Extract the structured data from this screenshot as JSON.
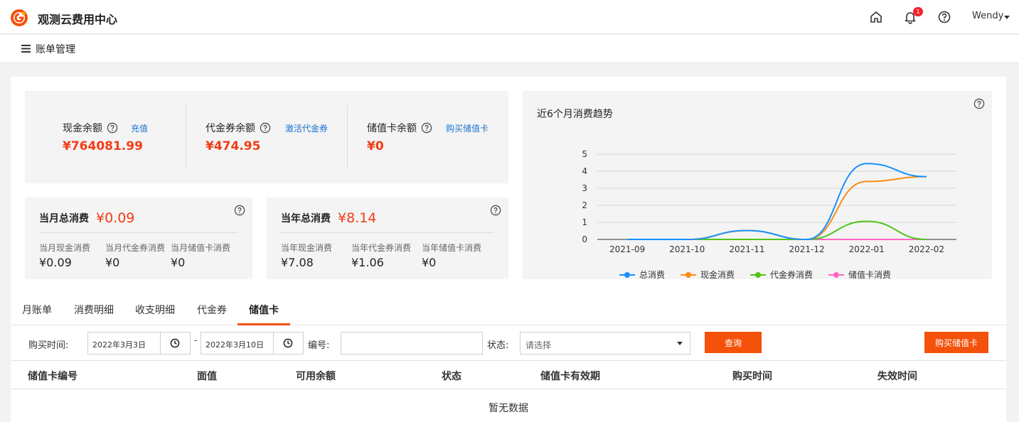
{
  "header": {
    "title": "观测云费用中心",
    "bell_count": "1",
    "user": "Wendy"
  },
  "subnav": {
    "title": "账单管理"
  },
  "balances": [
    {
      "label": "现金余额",
      "link": "充值",
      "value": "¥764081.99"
    },
    {
      "label": "代金券余额",
      "link": "激活代金券",
      "value": "¥474.95"
    },
    {
      "label": "储值卡余额",
      "link": "购买储值卡",
      "value": "¥0"
    }
  ],
  "monthly": {
    "label": "当月总消费",
    "value": "¥0.09",
    "items": [
      {
        "label": "当月现金消费",
        "value": "¥0.09"
      },
      {
        "label": "当月代金券消费",
        "value": "¥0"
      },
      {
        "label": "当月储值卡消费",
        "value": "¥0"
      }
    ]
  },
  "yearly": {
    "label": "当年总消费",
    "value": "¥8.14",
    "items": [
      {
        "label": "当年现金消费",
        "value": "¥7.08"
      },
      {
        "label": "当年代金券消费",
        "value": "¥1.06"
      },
      {
        "label": "当年储值卡消费",
        "value": "¥0"
      }
    ]
  },
  "chart_data": {
    "type": "line",
    "title": "近6个月消费趋势",
    "categories": [
      "2021-09",
      "2021-10",
      "2021-11",
      "2021-12",
      "2022-01",
      "2022-02"
    ],
    "ylim": [
      0,
      5
    ],
    "yticks": [
      0,
      1,
      2,
      3,
      4,
      5
    ],
    "grid": true,
    "legend": "bottom",
    "series": [
      {
        "name": "总消费",
        "color": "#1890ff",
        "values": [
          0,
          0,
          0.52,
          0,
          4.45,
          3.68
        ]
      },
      {
        "name": "现金消费",
        "color": "#fa8c16",
        "values": [
          0,
          0,
          0.52,
          0,
          3.4,
          3.68
        ]
      },
      {
        "name": "代金券消费",
        "color": "#52c41a",
        "values": [
          0,
          0,
          0,
          0,
          1.06,
          0
        ]
      },
      {
        "name": "储值卡消费",
        "color": "#ff66c4",
        "values": [
          0,
          0,
          0,
          0,
          0,
          0
        ]
      }
    ]
  },
  "tabs": [
    "月账单",
    "消费明细",
    "收支明细",
    "代金券",
    "储值卡"
  ],
  "filter": {
    "time_label": "购买时间:",
    "start_date": "2022年3月3日",
    "end_date": "2022年3月10日",
    "dash": "-",
    "number_label": "编号:",
    "number_value": "",
    "status_label": "状态:",
    "status_placeholder": "请选择",
    "query_button": "查询",
    "buy_button": "购买储值卡"
  },
  "table": {
    "columns": [
      "储值卡编号",
      "面值",
      "可用余额",
      "状态",
      "储值卡有效期",
      "购买时间",
      "失效时间"
    ],
    "empty_text": "暂无数据"
  },
  "colors": {
    "accent": "#f4510b",
    "money": "#f23c15",
    "link": "#1a73d1"
  }
}
